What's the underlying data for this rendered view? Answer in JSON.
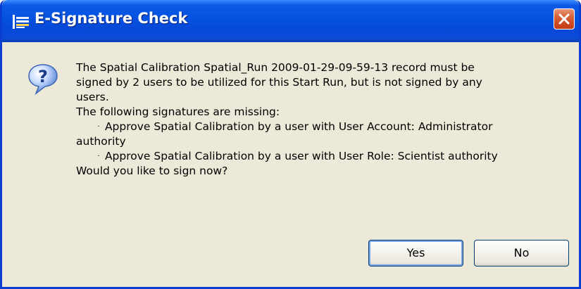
{
  "window": {
    "title": "E-Signature Check",
    "close_icon": "close-icon",
    "app_icon": "java-icon"
  },
  "dialog": {
    "icon": "question-icon",
    "message_lines": [
      "The Spatial Calibration Spatial_Run 2009-01-29-09-59-13 record must be",
      "signed by 2 users to be utilized for this Start Run, but is not signed by any",
      "users.",
      "The following signatures are missing:",
      "Approve Spatial Calibration by a user with User Account:  Administrator",
      "authority",
      "Approve Spatial Calibration by a user with User Role:  Scientist authority",
      "Would you like to sign now?"
    ],
    "bullet": "·"
  },
  "buttons": {
    "yes_label": "Yes",
    "no_label": "No"
  },
  "colors": {
    "titlebar": "#0551e0",
    "dialog_bg": "#ece9d8",
    "close_button": "#d9653d",
    "button_border": "#003c74"
  }
}
